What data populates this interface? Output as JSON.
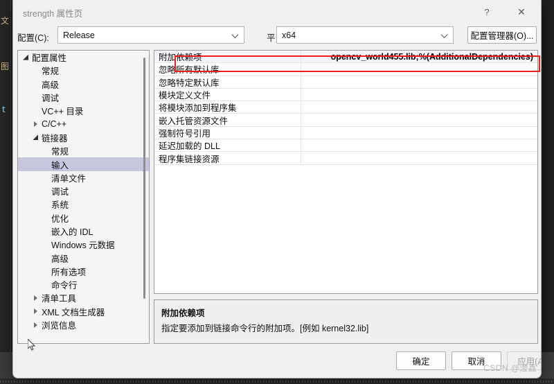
{
  "dialog": {
    "title": "strength 属性页",
    "help_icon": "?",
    "close_icon": "✕"
  },
  "config_bar": {
    "config_label": "配置(C):",
    "config_value": "Release",
    "platform_label": "平台(P):",
    "platform_value": "x64",
    "config_manager_button": "配置管理器(O)..."
  },
  "tree": {
    "nodes": [
      {
        "label": "配置属性",
        "indent": 0,
        "twisty": "down",
        "selected": false
      },
      {
        "label": "常规",
        "indent": 1,
        "twisty": "none",
        "selected": false
      },
      {
        "label": "高级",
        "indent": 1,
        "twisty": "none",
        "selected": false
      },
      {
        "label": "调试",
        "indent": 1,
        "twisty": "none",
        "selected": false
      },
      {
        "label": "VC++ 目录",
        "indent": 1,
        "twisty": "none",
        "selected": false
      },
      {
        "label": "C/C++",
        "indent": 1,
        "twisty": "right",
        "selected": false
      },
      {
        "label": "链接器",
        "indent": 1,
        "twisty": "down",
        "selected": false
      },
      {
        "label": "常规",
        "indent": 2,
        "twisty": "none",
        "selected": false
      },
      {
        "label": "输入",
        "indent": 2,
        "twisty": "none",
        "selected": true
      },
      {
        "label": "清单文件",
        "indent": 2,
        "twisty": "none",
        "selected": false
      },
      {
        "label": "调试",
        "indent": 2,
        "twisty": "none",
        "selected": false
      },
      {
        "label": "系统",
        "indent": 2,
        "twisty": "none",
        "selected": false
      },
      {
        "label": "优化",
        "indent": 2,
        "twisty": "none",
        "selected": false
      },
      {
        "label": "嵌入的 IDL",
        "indent": 2,
        "twisty": "none",
        "selected": false
      },
      {
        "label": "Windows 元数据",
        "indent": 2,
        "twisty": "none",
        "selected": false
      },
      {
        "label": "高级",
        "indent": 2,
        "twisty": "none",
        "selected": false
      },
      {
        "label": "所有选项",
        "indent": 2,
        "twisty": "none",
        "selected": false
      },
      {
        "label": "命令行",
        "indent": 2,
        "twisty": "none",
        "selected": false
      },
      {
        "label": "清单工具",
        "indent": 1,
        "twisty": "right",
        "selected": false
      },
      {
        "label": "XML 文档生成器",
        "indent": 1,
        "twisty": "right",
        "selected": false
      },
      {
        "label": "浏览信息",
        "indent": 1,
        "twisty": "right",
        "selected": false
      }
    ]
  },
  "grid": {
    "rows": [
      {
        "name": "附加依赖项",
        "value": "opencv_world455.lib;%(AdditionalDependencies)",
        "selected": true
      },
      {
        "name": "忽略所有默认库",
        "value": "",
        "selected": false
      },
      {
        "name": "忽略特定默认库",
        "value": "",
        "selected": false
      },
      {
        "name": "模块定义文件",
        "value": "",
        "selected": false
      },
      {
        "name": "将模块添加到程序集",
        "value": "",
        "selected": false
      },
      {
        "name": "嵌入托管资源文件",
        "value": "",
        "selected": false
      },
      {
        "name": "强制符号引用",
        "value": "",
        "selected": false
      },
      {
        "name": "延迟加载的 DLL",
        "value": "",
        "selected": false
      },
      {
        "name": "程序集链接资源",
        "value": "",
        "selected": false
      }
    ],
    "highlight_color": "#ef1c1c"
  },
  "description": {
    "title": "附加依赖项",
    "text": "指定要添加到链接命令行的附加项。[例如 kernel32.lib]"
  },
  "footer": {
    "ok": "确定",
    "cancel": "取消",
    "apply": "应用(A)"
  },
  "watermark": "CSDN @澄鑫",
  "backdrop": {
    "glyphs": [
      "文",
      "图",
      "t"
    ]
  }
}
